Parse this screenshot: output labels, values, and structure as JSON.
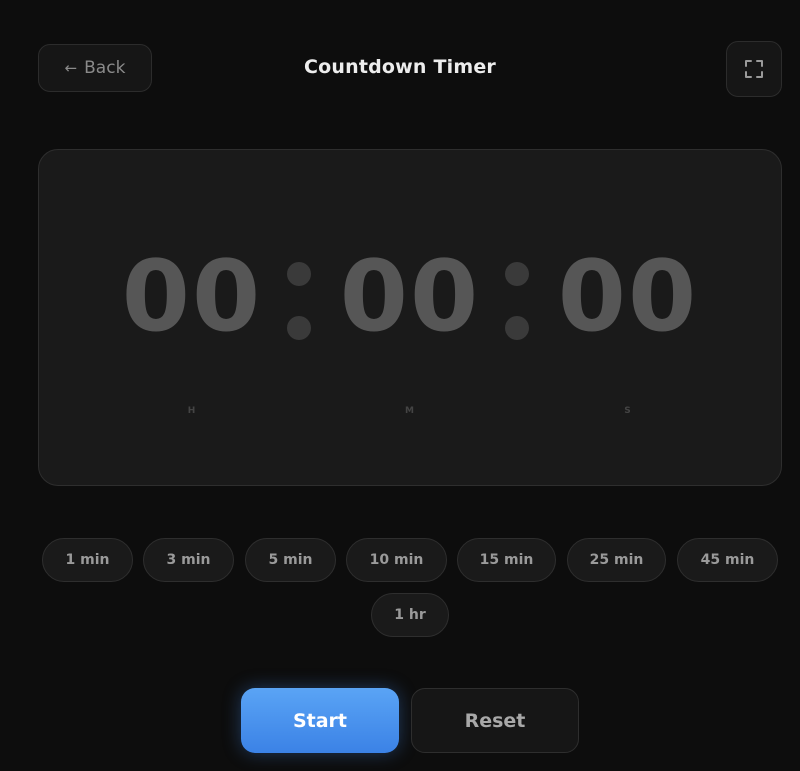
{
  "header": {
    "back_arrow": "←",
    "back_label": "Back",
    "title": "Countdown Timer",
    "fullscreen_icon": "fullscreen-icon"
  },
  "timer": {
    "hours": "00",
    "minutes": "00",
    "seconds": "00",
    "hours_label": "H",
    "minutes_label": "M",
    "seconds_label": "S",
    "digit_color": "#565656"
  },
  "presets": [
    {
      "label": "1 min"
    },
    {
      "label": "3 min"
    },
    {
      "label": "5 min"
    },
    {
      "label": "10 min"
    },
    {
      "label": "15 min"
    },
    {
      "label": "25 min"
    },
    {
      "label": "45 min"
    },
    {
      "label": "1 hr"
    }
  ],
  "controls": {
    "start_label": "Start",
    "reset_label": "Reset",
    "accent": "#4a93ee"
  }
}
